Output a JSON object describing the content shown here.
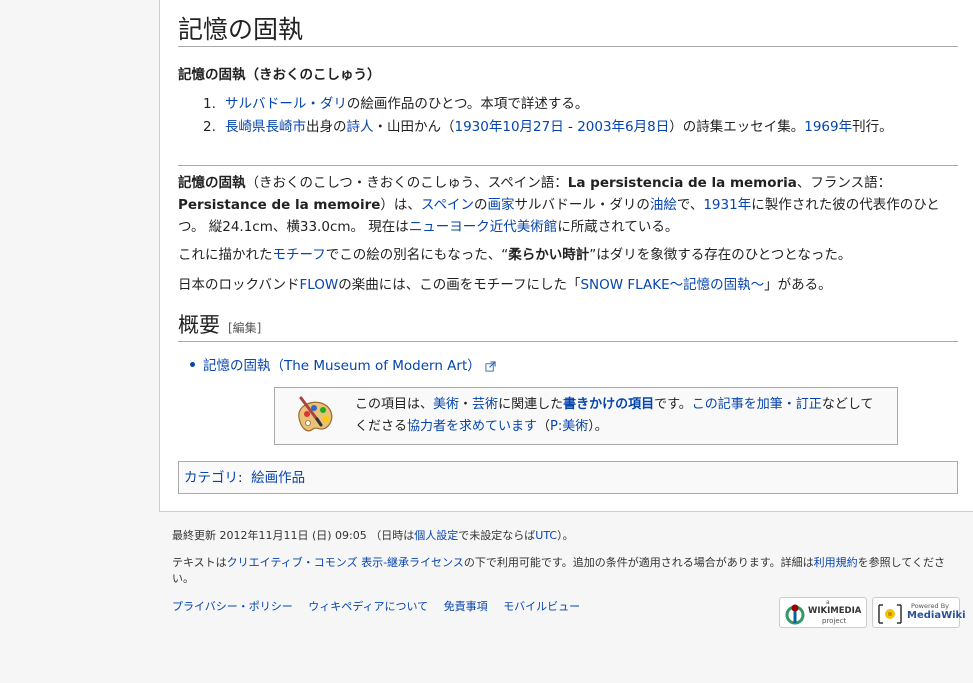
{
  "page": {
    "title": "記憶の固執",
    "disambig_heading": "記憶の固執（きおくのこしゅう）",
    "items": [
      {
        "num": "1.",
        "link": "サルバドール・ダリ",
        "rest": "の絵画作品のひとつ。本項で詳述する。"
      },
      {
        "num": "2.",
        "link1": "長崎県",
        "link2": "長崎市",
        "t1": "出身の",
        "link3": "詩人",
        "t2": "・山田かん（",
        "link4": "1930年10月27日",
        "t3": " - ",
        "link5": "2003年6月8日",
        "t4": "）の詩集エッセイ集。",
        "link6": "1969年",
        "t5": "刊行。"
      }
    ]
  },
  "article": {
    "p1": {
      "bold1": "記憶の固執",
      "t1": "（きおくのこしつ・きおくのこしゅう、スペイン語：",
      "bold2": "La persistencia de la memoria",
      "t2": "、フランス語：",
      "bold3": "Persistance de la memoire",
      "t3": "）は、",
      "l1": "スペイン",
      "t4": "の",
      "l2": "画家",
      "t5": "サルバドール・ダリの",
      "l3": "油絵",
      "t6": "で、",
      "l4": "1931年",
      "t7": "に製作された彼の代表作のひとつ。 縦24.1cm、横33.0cm。 現在は",
      "l5": "ニューヨーク近代美術館",
      "t8": "に所蔵されている。"
    },
    "p2": {
      "t1": "これに描かれた",
      "l1": "モチーフ",
      "t2": "でこの絵の別名にもなった、“",
      "bold": "柔らかい時計",
      "t3": "”はダリを象徴する存在のひとつとなった。"
    },
    "p3": {
      "t1": "日本のロックバンド",
      "l1": "FLOW",
      "t2": "の楽曲には、この画をモチーフにした「",
      "l2": "SNOW FLAKE〜記憶の固執〜",
      "t3": "」がある。"
    }
  },
  "section": {
    "heading": "概要",
    "edit": "[編集]",
    "ext_link": "記憶の固執（The Museum of Modern Art）"
  },
  "stub": {
    "t1": "この項目は、",
    "l1": "美術",
    "t2": "・",
    "l2": "芸術",
    "t3": "に関連した",
    "l3": "書きかけの項目",
    "t4": "です。",
    "l4": "この記事を加筆・訂正",
    "t5": "などしてくださる",
    "l5": "協力者を求めています",
    "t6": "（",
    "l6": "P:美術",
    "t7": "）。"
  },
  "categories": {
    "label": "カテゴリ",
    "sep": ":",
    "item": "絵画作品"
  },
  "footer": {
    "last_modified": "最終更新 2012年11月11日 (日) 09:05 （日時は",
    "lm_link1": "個人設定",
    "lm_mid": "で未設定ならば",
    "lm_link2": "UTC",
    "lm_end": "）。",
    "license_t1": "テキストは",
    "license_link": "クリエイティブ・コモンズ 表示-継承ライセンス",
    "license_t2": "の下で利用可能です。追加の条件が適用される場合があります。詳細は",
    "terms_link": "利用規約",
    "license_t3": "を参照してください。",
    "links": [
      "プライバシー・ポリシー",
      "ウィキペディアについて",
      "免責事項",
      "モバイルビュー"
    ],
    "wikimedia_top": "a",
    "wikimedia_name": "WIKIMEDIA",
    "wikimedia_sub": "project",
    "mediawiki_top": "Powered By",
    "mediawiki_name": "MediaWiki"
  },
  "colors": {
    "link": "#0645ad",
    "border": "#a7d7f9",
    "bg": "#f6f6f6"
  }
}
